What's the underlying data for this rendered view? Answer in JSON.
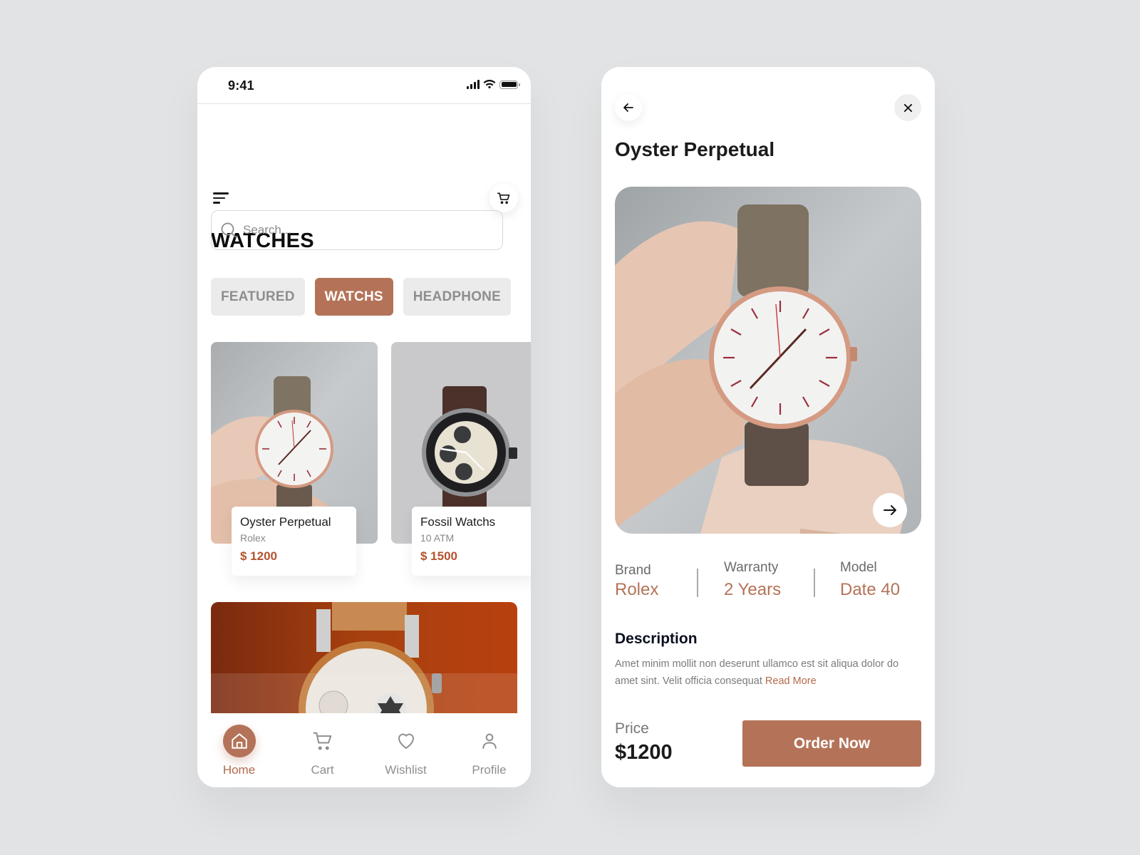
{
  "theme": {
    "accent": "#b47358",
    "price_color": "#b4532f",
    "background": "#e2e3e5"
  },
  "list_screen": {
    "status_bar": {
      "time": "9:41",
      "icons": [
        "signal-icon",
        "wifi-icon",
        "battery-icon"
      ]
    },
    "header": {
      "menu_icon": "menu-icon",
      "cart_icon": "cart-icon",
      "title": "WATCHES"
    },
    "search": {
      "placeholder": "Search...",
      "value": "",
      "icon": "search-icon"
    },
    "categories": [
      {
        "label": "FEATURED",
        "active": false
      },
      {
        "label": "WATCHS",
        "active": true
      },
      {
        "label": "HEADPHONE",
        "active": false
      }
    ],
    "products": [
      {
        "name": "Oyster Perpetual",
        "subtitle": "Rolex",
        "price": "$ 1200",
        "image": "hand-holding-watch-photo"
      },
      {
        "name": "Fossil Watchs",
        "subtitle": "10 ATM",
        "price": "$ 1500",
        "image": "fossil-chronograph-photo"
      }
    ],
    "banner": {
      "image": "montblanc-watch-photo"
    },
    "bottom_nav": [
      {
        "label": "Home",
        "icon": "home-icon",
        "active": true
      },
      {
        "label": "Cart",
        "icon": "cart-icon",
        "active": false
      },
      {
        "label": "Wishlist",
        "icon": "heart-icon",
        "active": false
      },
      {
        "label": "Profile",
        "icon": "user-icon",
        "active": false
      }
    ]
  },
  "detail_screen": {
    "back_icon": "arrow-left-icon",
    "close_icon": "close-icon",
    "title": "Oyster Perpetual",
    "hero_image": "hand-holding-watch-photo",
    "next_icon": "arrow-right-icon",
    "specs": [
      {
        "label": "Brand",
        "value": "Rolex"
      },
      {
        "label": "Warranty",
        "value": "2 Years"
      },
      {
        "label": "Model",
        "value": "Date 40"
      }
    ],
    "description": {
      "title": "Description",
      "text": "Amet minim mollit non deserunt ullamco est sit aliqua dolor do amet sint. Velit officia consequat ",
      "read_more": "Read More"
    },
    "price": {
      "label": "Price",
      "value": "$1200"
    },
    "order_button": "Order Now"
  }
}
